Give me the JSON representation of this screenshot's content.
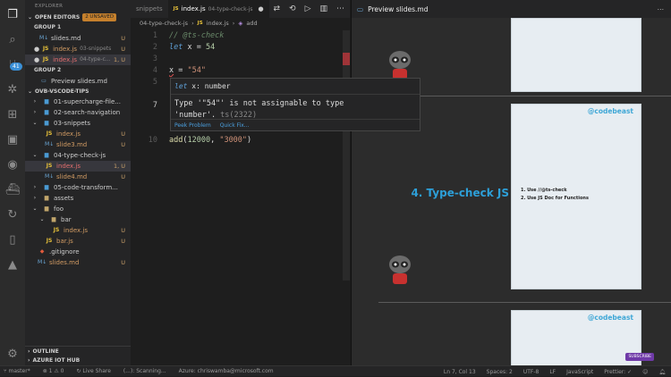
{
  "activity": {
    "badge": "41"
  },
  "sidebar": {
    "header": "EXPLORER",
    "open_editors": {
      "label": "OPEN EDITORS",
      "badge": "2 UNSAVED"
    },
    "groups": [
      {
        "label": "GROUP 1",
        "items": [
          {
            "name": "slides.md",
            "sub": "",
            "status": "U"
          },
          {
            "name": "index.js",
            "sub": "03-snippets",
            "status": "U"
          },
          {
            "name": "index.js",
            "sub": "04-type-c...",
            "status": "1, U"
          }
        ]
      },
      {
        "label": "GROUP 2",
        "items": [
          {
            "name": "Preview slides.md",
            "sub": "",
            "status": ""
          }
        ]
      }
    ],
    "project": "OVB-VSCODE-TIPS",
    "tree": [
      {
        "name": "01-supercharge-file...",
        "status": ""
      },
      {
        "name": "02-search-navigation",
        "status": ""
      },
      {
        "name": "03-snippets",
        "status": ""
      },
      {
        "name": "index.js",
        "status": "U"
      },
      {
        "name": "slide3.md",
        "status": "U"
      },
      {
        "name": "04-type-check-js",
        "status": ""
      },
      {
        "name": "index.js",
        "status": "1, U"
      },
      {
        "name": "slide4.md",
        "status": "U"
      },
      {
        "name": "05-code-transform...",
        "status": ""
      },
      {
        "name": "assets",
        "status": ""
      },
      {
        "name": "foo",
        "status": ""
      },
      {
        "name": "bar",
        "status": ""
      },
      {
        "name": "index.js",
        "status": "U"
      },
      {
        "name": "bar.js",
        "status": "U"
      },
      {
        "name": ".gitignore",
        "status": ""
      },
      {
        "name": "slides.md",
        "status": "U"
      }
    ],
    "outline": "OUTLINE",
    "azure": "AZURE IOT HUB"
  },
  "editor": {
    "tabs": [
      {
        "name": "snippets",
        "sub": ""
      },
      {
        "name": "index.js",
        "sub": "04-type-check-js"
      }
    ],
    "breadcrumb": [
      "04-type-check-js",
      "index.js",
      "add"
    ],
    "lines": {
      "n1": "1",
      "n2": "2",
      "n3": "3",
      "n4": "4",
      "n5": "5",
      "n7": "7",
      "n10": "10",
      "l1": "// @ts-check",
      "l2_kw": "let",
      "l2_rest": " x = ",
      "l2_num": "54",
      "l4_var": "x",
      "l4_eq": " = ",
      "l4_str": "\"54\"",
      "l10_fn": "add",
      "l10_a": "(",
      "l10_num": "12000",
      "l10_b": ", ",
      "l10_str": "\"3000\"",
      "l10_c": ")"
    },
    "hover": {
      "sig_kw": "let",
      "sig": " x: number",
      "msg_a": "Type '\"54\"' is not assignable to type",
      "msg_b": "'number'.",
      "msg_code": " ts(2322)",
      "peek": "Peek Problem",
      "quickfix": "Quick Fix..."
    }
  },
  "preview": {
    "tab": "Preview slides.md",
    "slide_title": "4. Type-check JS",
    "handle": "@codebeast",
    "list": [
      "1.  Use //@ts-check",
      "2.  Use JS Doc for Functions"
    ],
    "subscribe": "SUBSCRIBE"
  },
  "statusbar": {
    "branch": "master*",
    "errors": "⊗ 1 ⚠ 0",
    "live": "Live Share",
    "scanning": "(...): Scanning...",
    "azure": "Azure: chriswamba@microsoft.com",
    "position": "Ln 7, Col 13",
    "spaces": "Spaces: 2",
    "encoding": "UTF-8",
    "eol": "LF",
    "language": "JavaScript",
    "prettier": "Prettier: ✓"
  }
}
